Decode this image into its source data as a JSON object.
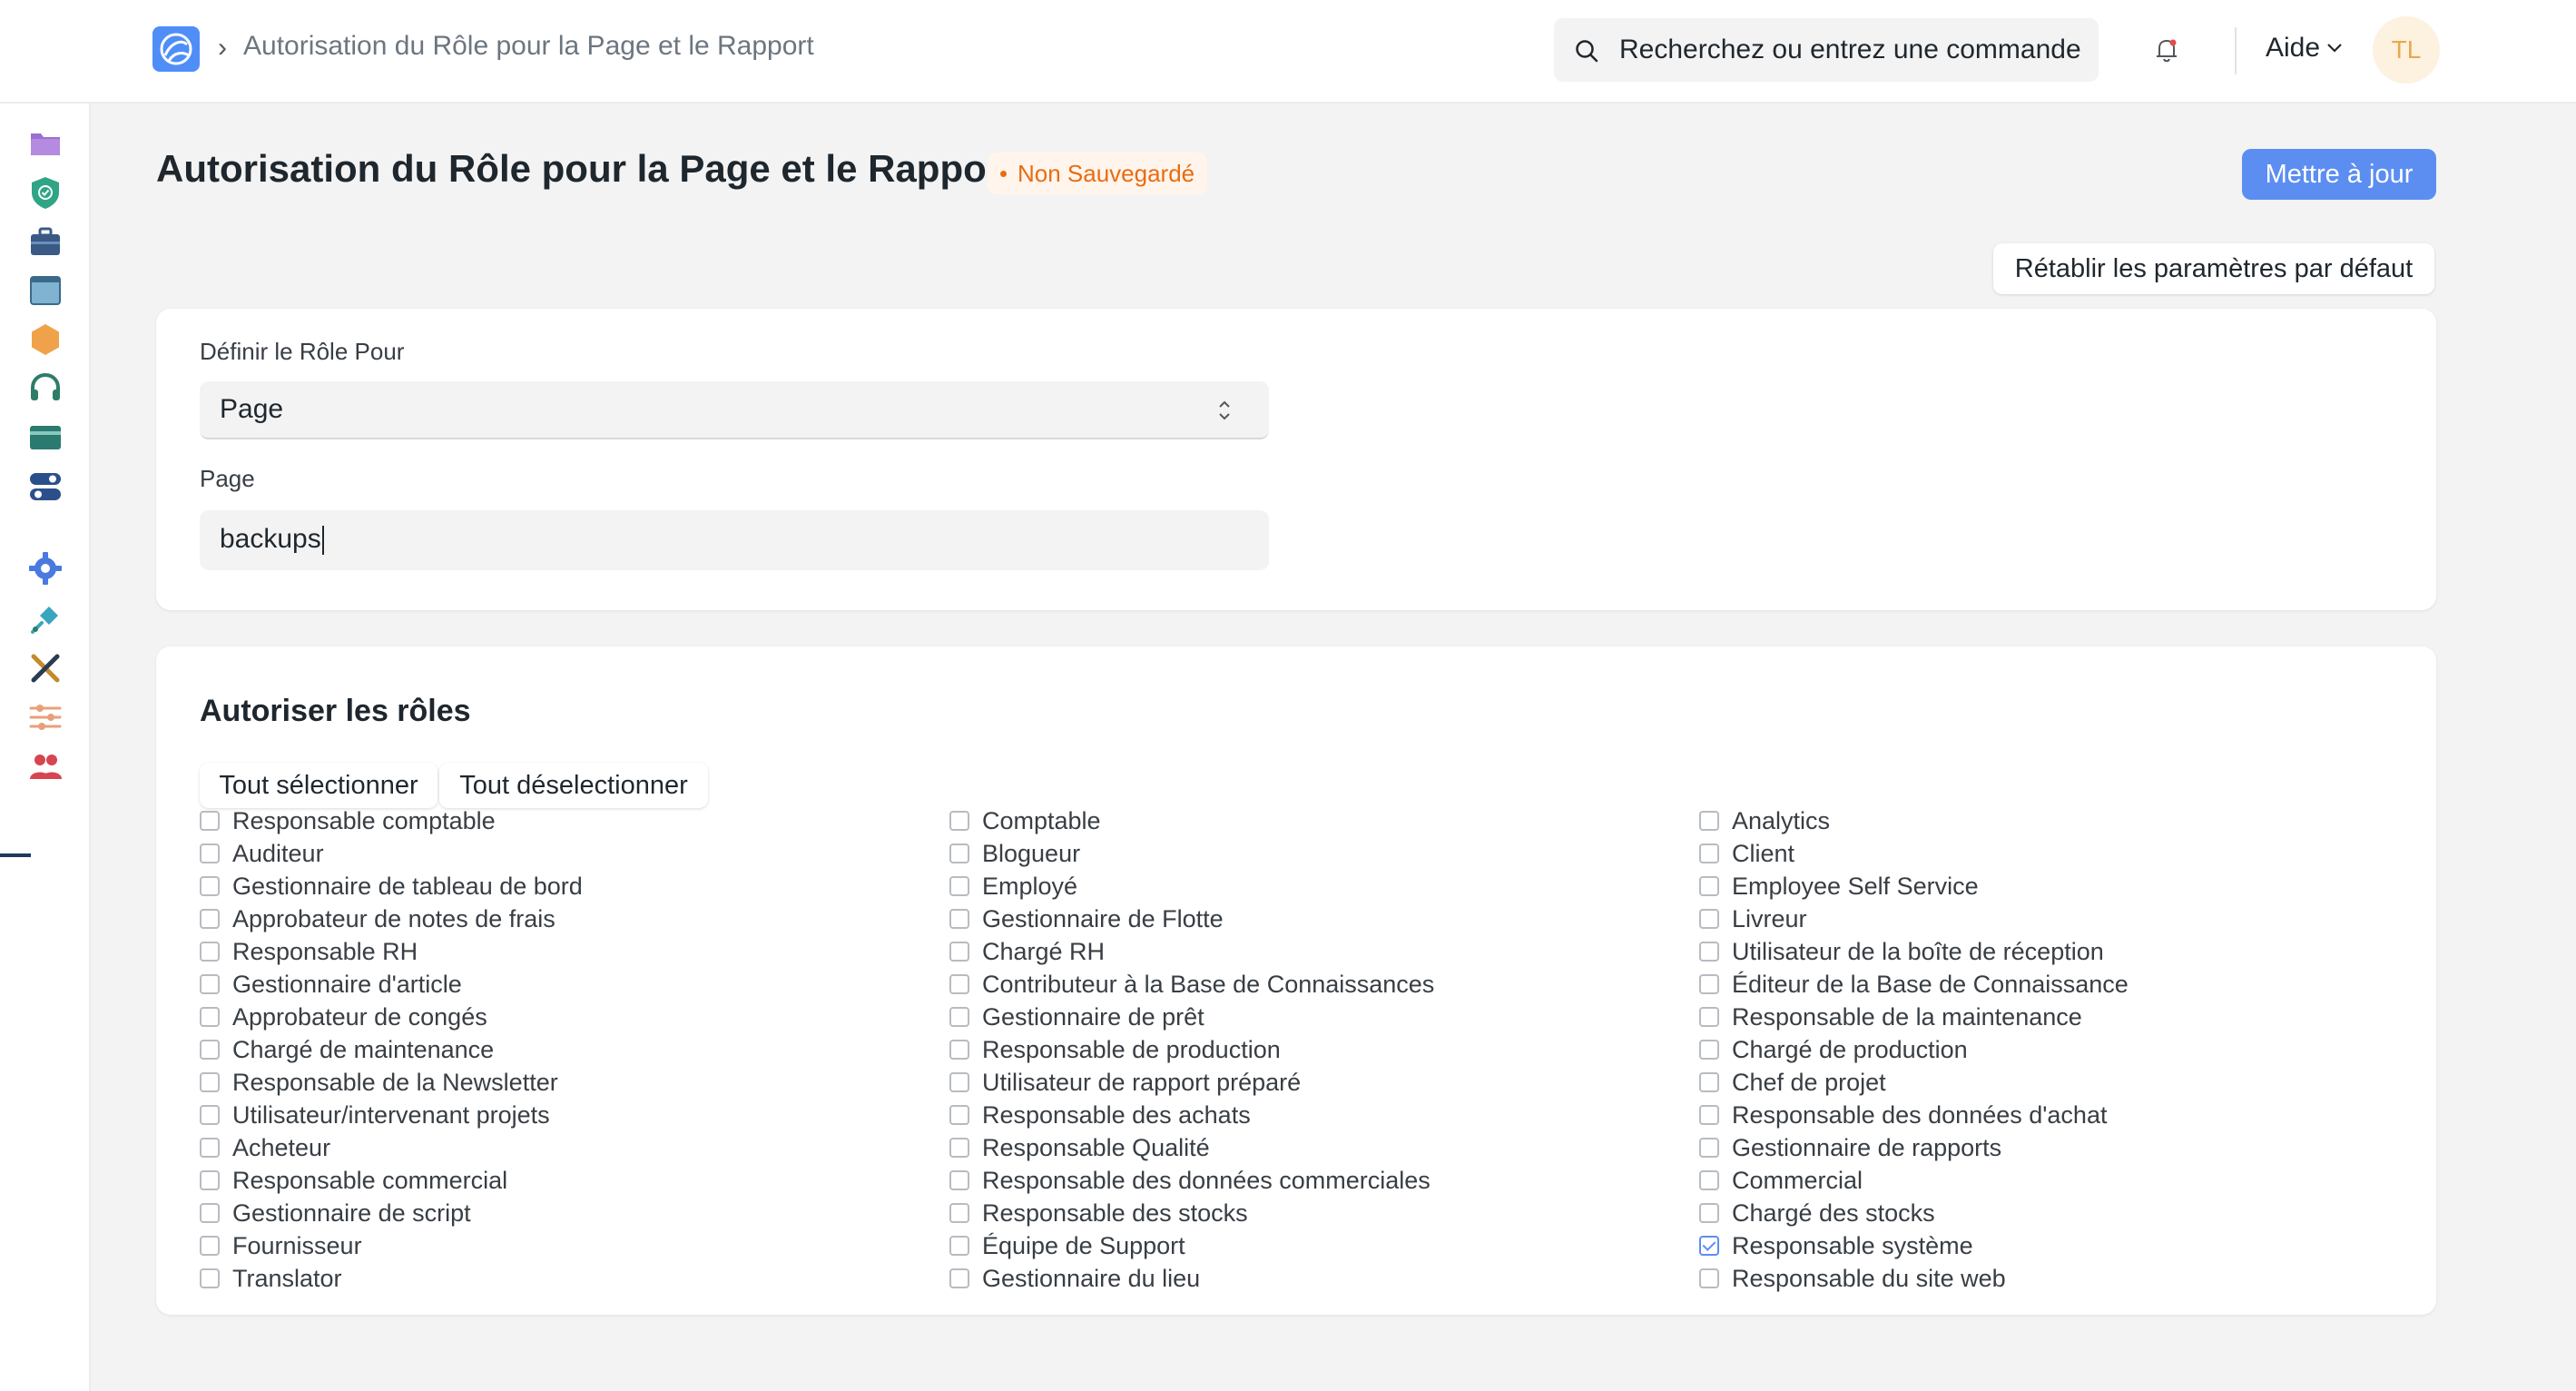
{
  "navbar": {
    "breadcrumb": "Autorisation du Rôle pour la Page et le Rapport",
    "search_placeholder": "Recherchez ou entrez une commande",
    "help_label": "Aide",
    "avatar_initials": "TL"
  },
  "sidebar": {
    "icons": [
      "folder-icon",
      "shield-icon",
      "briefcase-icon",
      "window-icon",
      "hexagon-icon",
      "headset-icon",
      "card-icon",
      "toggle-icon",
      "gear-icon",
      "plug-icon",
      "tools-icon",
      "sliders-icon",
      "users-icon"
    ]
  },
  "page": {
    "title": "Autorisation du Rôle pour la Page et le Rapport",
    "status": "Non Sauvegardé",
    "update_button": "Mettre à jour",
    "reset_button": "Rétablir les paramètres par défaut"
  },
  "form": {
    "set_role_for_label": "Définir le Rôle Pour",
    "set_role_for_value": "Page",
    "page_label": "Page",
    "page_value": "backups"
  },
  "roles": {
    "title": "Autoriser les rôles",
    "select_all": "Tout sélectionner",
    "deselect_all": "Tout déselectionner",
    "col1": [
      {
        "label": "Responsable comptable",
        "checked": false
      },
      {
        "label": "Auditeur",
        "checked": false
      },
      {
        "label": "Gestionnaire de tableau de bord",
        "checked": false
      },
      {
        "label": "Approbateur de notes de frais",
        "checked": false
      },
      {
        "label": "Responsable RH",
        "checked": false
      },
      {
        "label": "Gestionnaire d'article",
        "checked": false
      },
      {
        "label": "Approbateur de congés",
        "checked": false
      },
      {
        "label": "Chargé de maintenance",
        "checked": false
      },
      {
        "label": "Responsable de la Newsletter",
        "checked": false
      },
      {
        "label": "Utilisateur/intervenant projets",
        "checked": false
      },
      {
        "label": "Acheteur",
        "checked": false
      },
      {
        "label": "Responsable commercial",
        "checked": false
      },
      {
        "label": "Gestionnaire de script",
        "checked": false
      },
      {
        "label": "Fournisseur",
        "checked": false
      },
      {
        "label": "Translator",
        "checked": false
      }
    ],
    "col2": [
      {
        "label": "Comptable",
        "checked": false
      },
      {
        "label": "Blogueur",
        "checked": false
      },
      {
        "label": "Employé",
        "checked": false
      },
      {
        "label": "Gestionnaire de Flotte",
        "checked": false
      },
      {
        "label": "Chargé RH",
        "checked": false
      },
      {
        "label": "Contributeur à la Base de Connaissances",
        "checked": false
      },
      {
        "label": "Gestionnaire de prêt",
        "checked": false
      },
      {
        "label": "Responsable de production",
        "checked": false
      },
      {
        "label": "Utilisateur de rapport préparé",
        "checked": false
      },
      {
        "label": "Responsable des achats",
        "checked": false
      },
      {
        "label": "Responsable Qualité",
        "checked": false
      },
      {
        "label": "Responsable des données commerciales",
        "checked": false
      },
      {
        "label": "Responsable des stocks",
        "checked": false
      },
      {
        "label": "Équipe de Support",
        "checked": false
      },
      {
        "label": "Gestionnaire du lieu",
        "checked": false
      }
    ],
    "col3": [
      {
        "label": "Analytics",
        "checked": false
      },
      {
        "label": "Client",
        "checked": false
      },
      {
        "label": "Employee Self Service",
        "checked": false
      },
      {
        "label": "Livreur",
        "checked": false
      },
      {
        "label": "Utilisateur de la boîte de réception",
        "checked": false
      },
      {
        "label": "Éditeur de la Base de Connaissance",
        "checked": false
      },
      {
        "label": "Responsable de la maintenance",
        "checked": false
      },
      {
        "label": "Chargé de production",
        "checked": false
      },
      {
        "label": "Chef de projet",
        "checked": false
      },
      {
        "label": "Responsable des données d'achat",
        "checked": false
      },
      {
        "label": "Gestionnaire de rapports",
        "checked": false
      },
      {
        "label": "Commercial",
        "checked": false
      },
      {
        "label": "Chargé des stocks",
        "checked": false
      },
      {
        "label": "Responsable système",
        "checked": true
      },
      {
        "label": "Responsable du site web",
        "checked": false
      }
    ]
  },
  "colors": {
    "primary": "#5c8ef2",
    "status_orange": "#e86c13",
    "background": "#f3f3f3"
  }
}
